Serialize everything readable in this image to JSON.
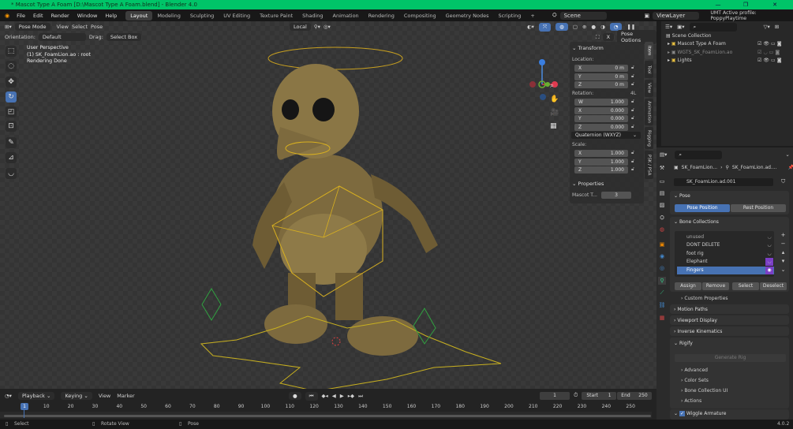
{
  "window": {
    "title": "* Mascot Type A Foam [D:\\Mascot Type A Foam.blend] - Blender 4.0",
    "minimize": "—",
    "maximize": "❐",
    "close": "✕",
    "accent": "#00c468"
  },
  "menu": [
    "File",
    "Edit",
    "Render",
    "Window",
    "Help"
  ],
  "workspaces": [
    "Layout",
    "Modeling",
    "Sculpting",
    "UV Editing",
    "Texture Paint",
    "Shading",
    "Animation",
    "Rendering",
    "Compositing",
    "Geometry Nodes",
    "Scripting",
    "+"
  ],
  "active_workspace": "Layout",
  "scene": {
    "name": "Scene",
    "view_layer": "ViewLayer",
    "profile": "UMT Active profile: PoppyPlaytime"
  },
  "viewport_header": {
    "mode": "Pose Mode",
    "menus": [
      "View",
      "Select",
      "Pose"
    ],
    "orientation_label": "Orientation:",
    "orientation": "Default",
    "drag_label": "Drag:",
    "drag": "Select Box",
    "pivot": "Local",
    "pose_options": "Pose Options"
  },
  "overlay": {
    "line1": "User Perspective",
    "line2": "(1) SK_FoamLion.ao : root",
    "line3": "Rendering Done"
  },
  "npanel": {
    "transform": "Transform",
    "location": "Location:",
    "rotation": "Rotation:",
    "rot_mode_tag": "4L",
    "scale": "Scale:",
    "loc": [
      {
        "axis": "X",
        "value": "0 m"
      },
      {
        "axis": "Y",
        "value": "0 m"
      },
      {
        "axis": "Z",
        "value": "0 m"
      }
    ],
    "rot": [
      {
        "axis": "W",
        "value": "1.000"
      },
      {
        "axis": "X",
        "value": "0.000"
      },
      {
        "axis": "Y",
        "value": "0.000"
      },
      {
        "axis": "Z",
        "value": "0.000"
      }
    ],
    "rot_mode": "Quaternion (WXYZ)",
    "scl": [
      {
        "axis": "X",
        "value": "1.000"
      },
      {
        "axis": "Y",
        "value": "1.000"
      },
      {
        "axis": "Z",
        "value": "1.000"
      }
    ],
    "properties": "Properties",
    "prop_name": "Mascot T...",
    "prop_value": "3",
    "tabs": [
      "Item",
      "Tool",
      "View",
      "Animation",
      "Rigging",
      "PSK / PSA"
    ]
  },
  "outliner": {
    "root": "Scene Collection",
    "items": [
      {
        "name": "Mascot Type A Foam"
      },
      {
        "name": "WGTS_SK_FoamLion.ao"
      },
      {
        "name": "Lights"
      }
    ]
  },
  "properties": {
    "breadcrumb1": "SK_FoamLion...",
    "breadcrumb2": "SK_FoamLion.ad....",
    "armature": "SK_FoamLion.ad.001",
    "pose": "Pose",
    "pose_position": "Pose Position",
    "rest_position": "Rest Position",
    "bone_collections": "Bone Collections",
    "collections": [
      {
        "name": "unused"
      },
      {
        "name": "DONT DELETE"
      },
      {
        "name": "foot rig"
      },
      {
        "name": "Elephant"
      },
      {
        "name": "Fingers"
      }
    ],
    "assign": "Assign",
    "remove": "Remove",
    "select": "Select",
    "deselect": "Deselect",
    "custom_props": "Custom Properties",
    "motion_paths": "Motion Paths",
    "viewport_display": "Viewport Display",
    "ik": "Inverse Kinematics",
    "rigify": "Rigify",
    "generate_rig": "Generate Rig",
    "advanced": "Advanced",
    "color_sets": "Color Sets",
    "bone_collection_ui": "Bone Collection UI",
    "actions": "Actions",
    "wiggle": "Wiggle Armature"
  },
  "timeline": {
    "menus": [
      "Playback",
      "Keying",
      "View",
      "Marker"
    ],
    "current_frame": "1",
    "start_label": "Start",
    "start": "1",
    "end_label": "End",
    "end": "250",
    "ticks": [
      "10",
      "20",
      "30",
      "40",
      "50",
      "60",
      "70",
      "80",
      "90",
      "100",
      "110",
      "120",
      "130",
      "140",
      "150",
      "160",
      "170",
      "180",
      "190",
      "200",
      "210",
      "220",
      "230",
      "240",
      "250"
    ]
  },
  "statusbar": {
    "select": "Select",
    "rotate": "Rotate View",
    "pose": "Pose",
    "version": "4.0.2"
  }
}
